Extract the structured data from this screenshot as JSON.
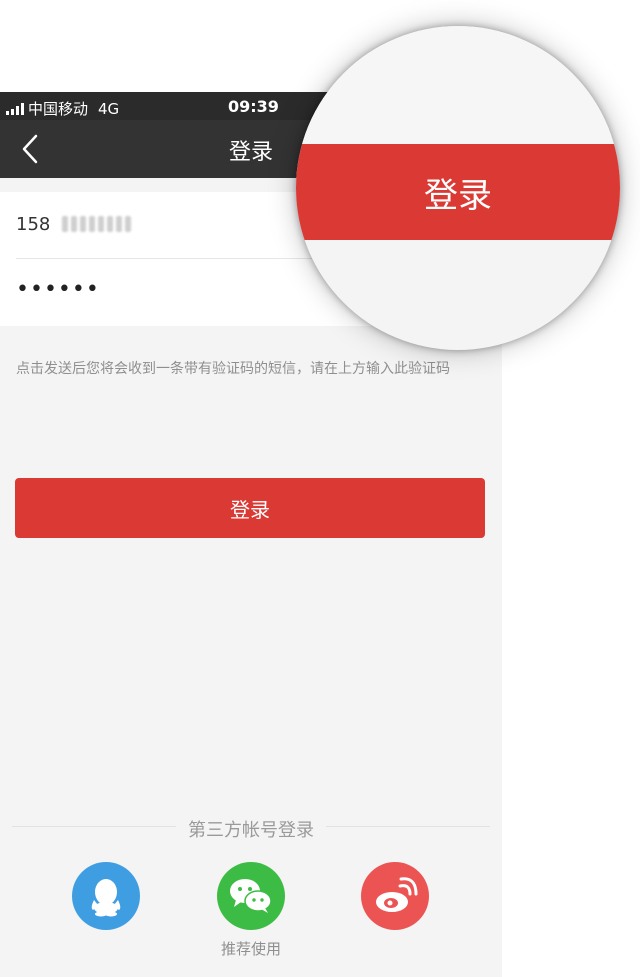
{
  "status_bar": {
    "carrier": "中国移动",
    "network": "4G",
    "time": "09:39"
  },
  "nav": {
    "title": "登录",
    "back_icon": "chevron-left-icon"
  },
  "form": {
    "phone_value": "158",
    "password_value": "••••••"
  },
  "hint": "点击发送后您将会收到一条带有验证码的短信，请在上方输入此验证码",
  "login_button": {
    "label": "登录"
  },
  "third_party": {
    "title": "第三方帐号登录",
    "items": [
      {
        "icon": "qq-icon",
        "color": "#3f9ee2"
      },
      {
        "icon": "wechat-icon",
        "color": "#3dbc45"
      },
      {
        "icon": "weibo-icon",
        "color": "#ec5454"
      }
    ],
    "recommend_label": "推荐使用"
  },
  "magnifier": {
    "label": "登录"
  },
  "colors": {
    "accent": "#db3a34",
    "nav_bg": "#333333"
  }
}
